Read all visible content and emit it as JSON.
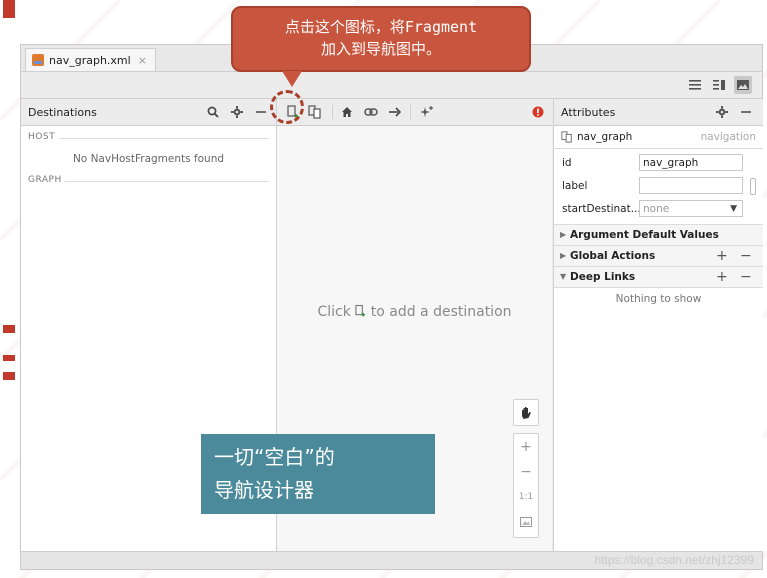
{
  "file_tab": {
    "label": "nav_graph.xml",
    "close": "×"
  },
  "destinations": {
    "title": "Destinations",
    "host_label": "HOST",
    "host_empty": "No NavHostFragments found",
    "graph_label": "GRAPH"
  },
  "canvas": {
    "empty_prefix": "Click",
    "empty_suffix": "to add a destination",
    "zoom": {
      "plus": "+",
      "minus": "−",
      "actual": "1:1"
    }
  },
  "attributes": {
    "title": "Attributes",
    "graph_name": "nav_graph",
    "graph_type": "navigation",
    "fields": [
      {
        "key": "id",
        "value": "nav_graph"
      },
      {
        "key": "label",
        "value": ""
      },
      {
        "key": "startDestinat...",
        "value": "none"
      }
    ],
    "groups": [
      {
        "label": "Argument Default Values",
        "expanded": false
      },
      {
        "label": "Global Actions",
        "expanded": false
      },
      {
        "label": "Deep Links",
        "expanded": true
      }
    ],
    "empty": "Nothing to show"
  },
  "annotations": {
    "top_line1": "点击这个图标，将Fragment",
    "top_line2": "加入到导航图中。",
    "bottom_line1": "一切“空白”的",
    "bottom_line2": "导航设计器"
  },
  "watermark": "https://blog.csdn.net/zhj12399",
  "colors": {
    "callout_red": "#c8553d",
    "callout_teal": "#4b8a9a",
    "error_red": "#d9382c"
  }
}
